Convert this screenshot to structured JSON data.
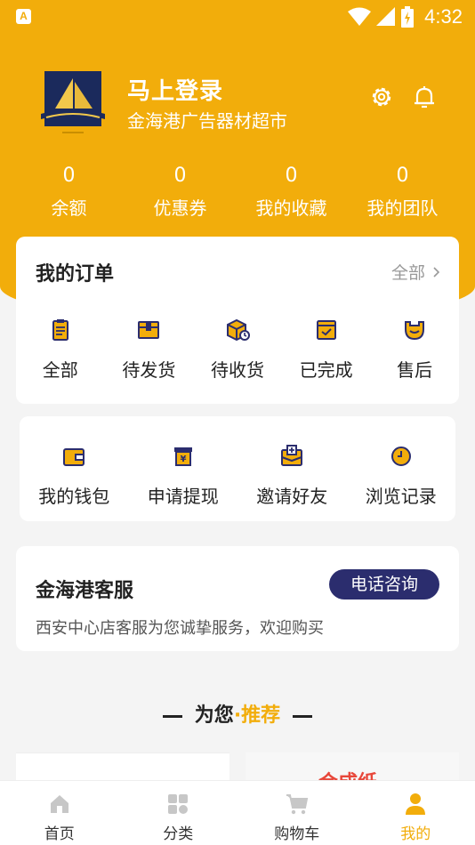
{
  "status_bar": {
    "time": "4:32",
    "app_icon_letter": "A"
  },
  "profile": {
    "name": "马上登录",
    "shop": "金海港广告器材超市"
  },
  "stats": [
    {
      "value": "0",
      "label": "余额"
    },
    {
      "value": "0",
      "label": "优惠券"
    },
    {
      "value": "0",
      "label": "我的收藏"
    },
    {
      "value": "0",
      "label": "我的团队"
    }
  ],
  "orders": {
    "title": "我的订单",
    "see_all": "全部",
    "items": [
      {
        "label": "全部",
        "icon": "clipboard-icon"
      },
      {
        "label": "待发货",
        "icon": "box-icon"
      },
      {
        "label": "待收货",
        "icon": "package-icon"
      },
      {
        "label": "已完成",
        "icon": "check-box-icon"
      },
      {
        "label": "售后",
        "icon": "wrench-icon"
      }
    ]
  },
  "tools": [
    {
      "label": "我的钱包",
      "icon": "wallet-icon"
    },
    {
      "label": "申请提现",
      "icon": "withdraw-icon"
    },
    {
      "label": "邀请好友",
      "icon": "invite-icon"
    },
    {
      "label": "浏览记录",
      "icon": "clock-icon"
    }
  ],
  "service": {
    "title": "金海港客服",
    "button": "电话咨询",
    "description": "西安中心店客服为您诚挚服务，欢迎购买"
  },
  "recommend": {
    "prefix": "为您",
    "dot": "·",
    "highlight": "推荐"
  },
  "product_peek": {
    "text": "合成纸"
  },
  "tabs": [
    {
      "label": "首页",
      "icon": "home-icon",
      "active": false
    },
    {
      "label": "分类",
      "icon": "category-icon",
      "active": false
    },
    {
      "label": "购物车",
      "icon": "cart-icon",
      "active": false
    },
    {
      "label": "我的",
      "icon": "user-icon",
      "active": true
    }
  ],
  "colors": {
    "brand": "#f2ad0b",
    "service_button": "#2b2d6e"
  }
}
